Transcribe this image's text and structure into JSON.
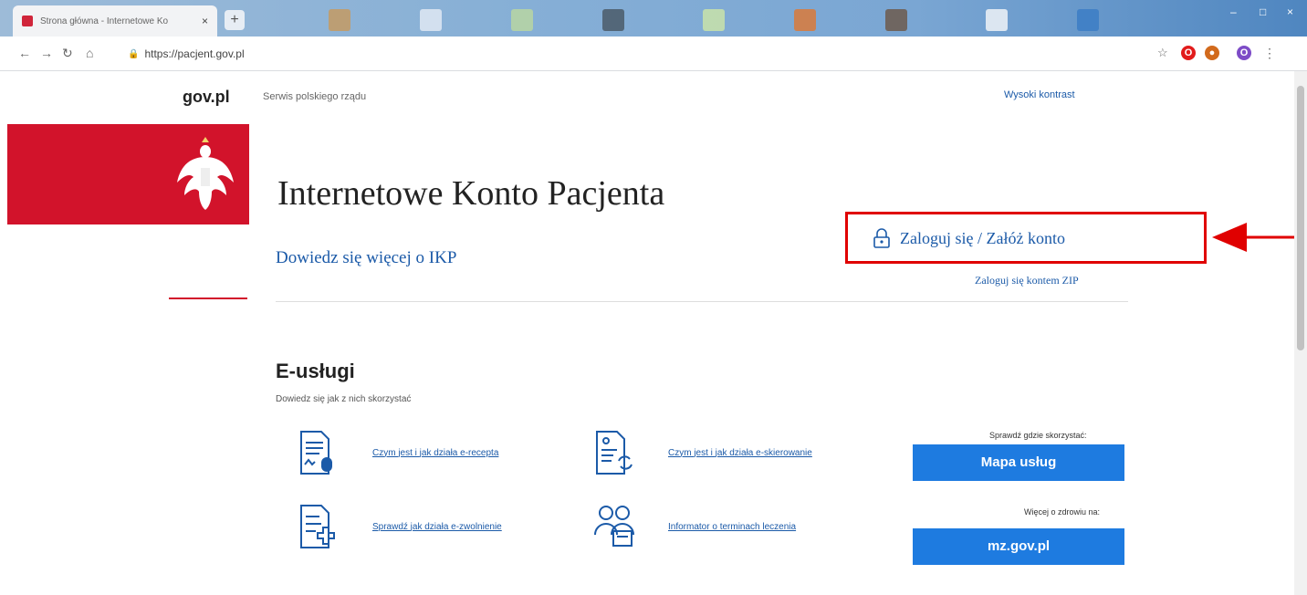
{
  "browser": {
    "tab_title": "Strona główna - Internetowe Ko",
    "tab_close": "×",
    "new_tab": "+",
    "url": "https://pacjent.gov.pl",
    "window_controls": [
      "–",
      "□",
      "×"
    ]
  },
  "header": {
    "site_name": "gov.pl",
    "tagline": "Serwis polskiego rządu",
    "contrast_link": "Wysoki kontrast"
  },
  "main": {
    "title": "Internetowe Konto Pacjenta",
    "learn_more": "Dowiedz się więcej o IKP",
    "login_link": "Zaloguj się / Załóż konto",
    "zip_login": "Zaloguj się kontem ZIP"
  },
  "eservices": {
    "heading": "E-usługi",
    "subheading": "Dowiedz się jak z nich skorzystać",
    "items": [
      {
        "label": "Czym jest i jak działa e-recepta",
        "icon": "e-prescription-icon"
      },
      {
        "label": "Czym jest i jak działa e-skierowanie",
        "icon": "e-referral-icon"
      },
      {
        "label": "Sprawdź jak działa e-zwolnienie",
        "icon": "e-sick-leave-icon"
      },
      {
        "label": "Informator o terminach leczenia",
        "icon": "treatment-dates-icon"
      }
    ],
    "map_hint": "Sprawdź gdzie skorzystać:",
    "map_button": "Mapa usług",
    "health_hint": "Więcej o zdrowiu na:",
    "health_button": "mz.gov.pl"
  },
  "colors": {
    "gov_red": "#d2132b",
    "link_blue": "#1b5aa8",
    "button_blue": "#1e7be0",
    "highlight_red": "#e00000"
  }
}
